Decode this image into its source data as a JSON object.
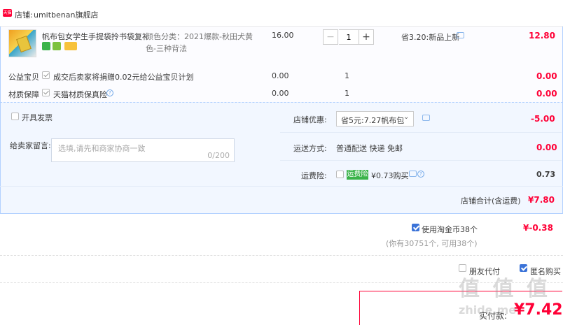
{
  "shop": {
    "label": "店铺:",
    "name": "umitbenan旗舰店"
  },
  "item": {
    "title": "帆布包女学生手提袋拎书袋复补...",
    "attr_line1": "颜色分类：2021爆款-秋田犬黄",
    "attr_line2": "色-三种背法",
    "unit_price": "16.00",
    "quantity": "1",
    "minus": "−",
    "plus": "+",
    "promo": "省3.20:新品上新",
    "total": "12.80"
  },
  "charity": {
    "label": "公益宝贝",
    "text": "成交后卖家将捐赠0.02元给公益宝贝计划",
    "price": "0.00",
    "qty": "1",
    "total": "0.00"
  },
  "insurance": {
    "label": "材质保障",
    "text": "天猫材质保真险",
    "price": "0.00",
    "qty": "1",
    "total": "0.00"
  },
  "invoice": {
    "label": "开具发票"
  },
  "message": {
    "label": "给卖家留言:",
    "placeholder": "选填,请先和商家协商一致",
    "counter": "0/200"
  },
  "coupon": {
    "label": "店铺优惠:",
    "value": "省5元:7.27帆布包",
    "amount": "-5.00"
  },
  "shipping": {
    "label": "运送方式:",
    "value": "普通配送 快递 免邮",
    "amount": "0.00"
  },
  "freight_ins": {
    "label": "运费险:",
    "tag": "运费险",
    "value": "¥0.73购买",
    "amount": "0.73"
  },
  "subtotal": {
    "label": "店铺合计(含运费)",
    "amount": "¥7.80"
  },
  "coins": {
    "label": "使用淘金币38个",
    "amount": "¥-0.38",
    "note": "(你有30751个, 可用38个)"
  },
  "options": {
    "proxy_pay": "朋友代付",
    "anonymous": "匿名购买"
  },
  "payment": {
    "label": "实付款:",
    "amount": "¥7.42"
  },
  "watermark": {
    "text": "值 值 值",
    "site": "zhide.me"
  },
  "colors": {
    "accent": "#ff0036",
    "panel": "#f2f7ff",
    "border": "#b2d1ff",
    "check_blue": "#3b73d8"
  }
}
